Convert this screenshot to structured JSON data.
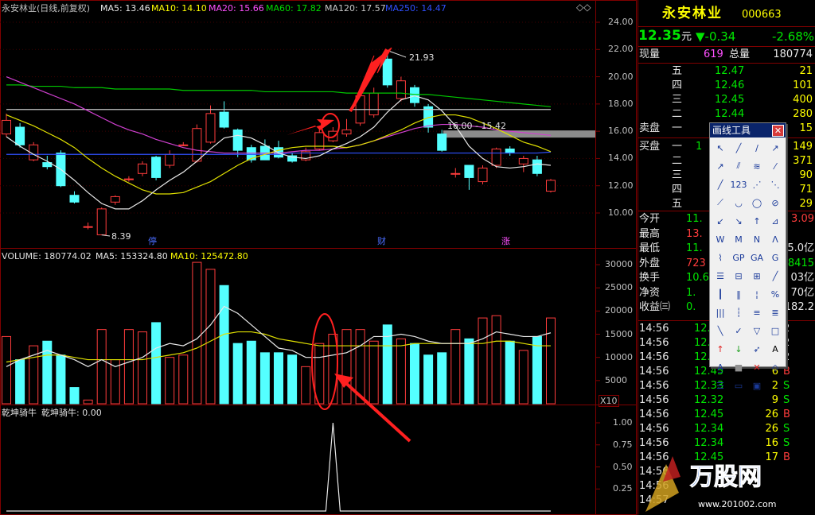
{
  "chart_header": {
    "title": "永安林业(日线,前复权)",
    "ma5": "MA5: 13.46",
    "ma10": "MA10: 14.10",
    "ma20": "MA20: 15.66",
    "ma60": "MA60: 17.82",
    "ma120": "MA120: 17.57",
    "ma250": "MA250: 14.47"
  },
  "price_axis": [
    "24.00",
    "22.00",
    "20.00",
    "18.00",
    "16.00",
    "14.00",
    "12.00",
    "10.00"
  ],
  "annotations": {
    "high": "21.93",
    "low": "8.39",
    "range": "16.00 - 15.42",
    "markers": [
      "停",
      "财",
      "涨"
    ]
  },
  "volume_header": {
    "label": "VOLUME: 180774.02",
    "ma5": "MA5: 153324.80",
    "ma10": "MA10: 125472.80"
  },
  "volume_axis": [
    "30000",
    "25000",
    "20000",
    "15000",
    "10000",
    "5000"
  ],
  "volume_unit": "X10",
  "indicator_header": {
    "name": "乾坤骑牛",
    "value": "乾坤骑牛: 0.00"
  },
  "indicator_axis": [
    "1.00",
    "0.75",
    "0.50",
    "0.25"
  ],
  "chart_data": {
    "type": "candlestick",
    "candles": [
      {
        "o": 15.8,
        "c": 16.8,
        "h": 17.3,
        "l": 15.6
      },
      {
        "o": 16.3,
        "c": 15.0,
        "h": 16.6,
        "l": 14.8
      },
      {
        "o": 13.9,
        "c": 15.0,
        "h": 15.2,
        "l": 13.8
      },
      {
        "o": 13.7,
        "c": 13.4,
        "h": 14.2,
        "l": 13.2
      },
      {
        "o": 14.4,
        "c": 12.0,
        "h": 14.6,
        "l": 11.9
      },
      {
        "o": 11.3,
        "c": 10.8,
        "h": 11.6,
        "l": 10.7
      },
      {
        "o": 9.0,
        "c": 9.0,
        "h": 9.3,
        "l": 8.8
      },
      {
        "o": 8.4,
        "c": 10.3,
        "h": 10.4,
        "l": 8.39
      },
      {
        "o": 10.8,
        "c": 11.2,
        "h": 11.3,
        "l": 10.6
      },
      {
        "o": 12.5,
        "c": 12.5,
        "h": 12.7,
        "l": 12.3
      },
      {
        "o": 12.9,
        "c": 13.6,
        "h": 13.8,
        "l": 12.7
      },
      {
        "o": 14.1,
        "c": 12.6,
        "h": 14.2,
        "l": 12.4
      },
      {
        "o": 13.5,
        "c": 14.3,
        "h": 14.6,
        "l": 13.3
      },
      {
        "o": 15.0,
        "c": 15.0,
        "h": 15.2,
        "l": 14.9
      },
      {
        "o": 13.8,
        "c": 16.2,
        "h": 16.5,
        "l": 13.7
      },
      {
        "o": 15.2,
        "c": 17.3,
        "h": 17.9,
        "l": 15.1
      },
      {
        "o": 17.4,
        "c": 16.3,
        "h": 18.2,
        "l": 16.2
      },
      {
        "o": 16.1,
        "c": 14.6,
        "h": 16.2,
        "l": 14.1
      },
      {
        "o": 14.8,
        "c": 13.9,
        "h": 15.0,
        "l": 13.7
      },
      {
        "o": 14.9,
        "c": 13.9,
        "h": 15.4,
        "l": 13.9
      },
      {
        "o": 14.8,
        "c": 14.1,
        "h": 15.3,
        "l": 14.0
      },
      {
        "o": 14.2,
        "c": 13.8,
        "h": 14.4,
        "l": 13.7
      },
      {
        "o": 13.9,
        "c": 14.5,
        "h": 14.8,
        "l": 13.8
      },
      {
        "o": 14.7,
        "c": 15.9,
        "h": 16.2,
        "l": 14.6
      },
      {
        "o": 15.3,
        "c": 16.0,
        "h": 16.3,
        "l": 15.2
      },
      {
        "o": 15.8,
        "c": 16.1,
        "h": 16.9,
        "l": 15.6
      },
      {
        "o": 16.6,
        "c": 18.6,
        "h": 18.8,
        "l": 16.4
      },
      {
        "o": 17.2,
        "c": 18.8,
        "h": 19.2,
        "l": 17.0
      },
      {
        "o": 21.3,
        "c": 19.4,
        "h": 21.93,
        "l": 19.2
      },
      {
        "o": 18.4,
        "c": 19.7,
        "h": 20.0,
        "l": 18.2
      },
      {
        "o": 19.2,
        "c": 18.1,
        "h": 19.4,
        "l": 17.8
      },
      {
        "o": 17.8,
        "c": 16.3,
        "h": 18.0,
        "l": 15.9
      },
      {
        "o": 15.8,
        "c": 14.6,
        "h": 16.1,
        "l": 14.5
      },
      {
        "o": 12.9,
        "c": 12.9,
        "h": 13.3,
        "l": 12.6
      },
      {
        "o": 13.5,
        "c": 12.6,
        "h": 13.5,
        "l": 11.7
      },
      {
        "o": 12.3,
        "c": 13.3,
        "h": 13.5,
        "l": 12.1
      },
      {
        "o": 13.5,
        "c": 14.7,
        "h": 14.8,
        "l": 13.3
      },
      {
        "o": 14.7,
        "c": 14.4,
        "h": 14.9,
        "l": 14.2
      },
      {
        "o": 13.6,
        "c": 14.0,
        "h": 14.2,
        "l": 13.0
      },
      {
        "o": 13.9,
        "c": 12.9,
        "h": 14.2,
        "l": 12.7
      },
      {
        "o": 11.6,
        "c": 12.4,
        "h": 12.5,
        "l": 11.5
      }
    ],
    "volume": [
      14500,
      9500,
      12500,
      13500,
      10500,
      3500,
      800,
      16000,
      9500,
      16000,
      15500,
      17500,
      10000,
      10500,
      30500,
      29000,
      25500,
      13000,
      13500,
      11000,
      11000,
      10500,
      8000,
      13000,
      15000,
      16000,
      16000,
      13500,
      17000,
      14000,
      13000,
      10500,
      11000,
      16000,
      14000,
      18500,
      19000,
      13500,
      11500,
      14500,
      18500
    ],
    "ma5_price": [
      15.6,
      14.9,
      14.3,
      13.8,
      13.2,
      12.4,
      11.5,
      10.7,
      10.3,
      10.3,
      10.9,
      11.7,
      12.4,
      13.0,
      13.8,
      14.7,
      15.5,
      15.7,
      15.5,
      15.0,
      14.4,
      14.1,
      14.0,
      14.2,
      14.7,
      15.1,
      15.6,
      16.3,
      17.4,
      18.3,
      18.6,
      18.3,
      17.5,
      16.4,
      14.9,
      14.0,
      13.4,
      13.3,
      13.4,
      13.6,
      13.5
    ],
    "ma10_price": [
      17.2,
      16.8,
      16.4,
      15.9,
      15.4,
      14.8,
      14.0,
      13.3,
      12.7,
      12.2,
      11.7,
      11.4,
      11.4,
      11.5,
      11.9,
      12.3,
      12.9,
      13.5,
      14.0,
      14.3,
      14.6,
      14.8,
      14.9,
      14.9,
      14.9,
      14.8,
      15.0,
      15.3,
      15.7,
      16.1,
      16.6,
      17.0,
      17.2,
      17.2,
      17.0,
      16.6,
      16.2,
      15.7,
      15.2,
      14.9,
      14.5
    ],
    "ma20_price": [
      20.0,
      19.6,
      19.2,
      18.8,
      18.4,
      18.0,
      17.5,
      17.0,
      16.5,
      16.1,
      15.8,
      15.4,
      15.1,
      14.8,
      14.6,
      14.5,
      14.4,
      14.4,
      14.4,
      14.4,
      14.4,
      14.5,
      14.6,
      14.6,
      14.7,
      14.8,
      15.0,
      15.3,
      15.6,
      15.9,
      16.2,
      16.4,
      16.5,
      16.5,
      16.4,
      16.3,
      16.1,
      16.0,
      15.9,
      15.8,
      15.7
    ],
    "ma60_price": [
      19.4,
      19.4,
      19.3,
      19.3,
      19.3,
      19.2,
      19.2,
      19.2,
      19.1,
      19.1,
      19.1,
      19.1,
      19.1,
      19.0,
      19.0,
      19.0,
      19.0,
      19.0,
      19.0,
      18.9,
      18.9,
      18.9,
      18.9,
      18.9,
      18.9,
      18.8,
      18.8,
      18.8,
      18.8,
      18.8,
      18.7,
      18.7,
      18.6,
      18.5,
      18.4,
      18.3,
      18.2,
      18.1,
      18.0,
      17.9,
      17.8
    ],
    "ma120_price": [
      17.6,
      17.6,
      17.6,
      17.6,
      17.6,
      17.6,
      17.6,
      17.6,
      17.6,
      17.6,
      17.6,
      17.6,
      17.6,
      17.6,
      17.6,
      17.6,
      17.6,
      17.6,
      17.6,
      17.6,
      17.6,
      17.6,
      17.6,
      17.6,
      17.6,
      17.6,
      17.6,
      17.6,
      17.6,
      17.6,
      17.6,
      17.6,
      17.6,
      17.6,
      17.6,
      17.6,
      17.6,
      17.6,
      17.6,
      17.6,
      17.6
    ],
    "ma250_price": [
      14.3,
      14.3,
      14.3,
      14.3,
      14.3,
      14.3,
      14.3,
      14.3,
      14.3,
      14.3,
      14.3,
      14.3,
      14.3,
      14.3,
      14.3,
      14.3,
      14.3,
      14.3,
      14.3,
      14.3,
      14.3,
      14.4,
      14.4,
      14.4,
      14.4,
      14.4,
      14.4,
      14.4,
      14.4,
      14.4,
      14.4,
      14.4,
      14.4,
      14.4,
      14.4,
      14.4,
      14.4,
      14.4,
      14.4,
      14.4,
      14.47
    ],
    "vol_ma5": [
      8000,
      9500,
      10500,
      11500,
      10500,
      9500,
      8000,
      9500,
      8000,
      9000,
      10000,
      12000,
      13000,
      12500,
      14000,
      17000,
      21000,
      19500,
      17000,
      14500,
      12000,
      11500,
      10000,
      10000,
      10500,
      11000,
      12500,
      14500,
      14500,
      15000,
      14500,
      13500,
      13000,
      13000,
      13000,
      14000,
      15500,
      15000,
      14500,
      14500,
      15300
    ],
    "vol_ma10": [
      9000,
      9500,
      10000,
      10500,
      10500,
      10000,
      9500,
      9500,
      9500,
      9500,
      9500,
      10000,
      10500,
      11000,
      12000,
      13500,
      15000,
      15500,
      15500,
      15000,
      14000,
      13500,
      13000,
      12500,
      12500,
      12500,
      12500,
      12500,
      12500,
      12500,
      13000,
      13000,
      13000,
      13000,
      13000,
      13000,
      13500,
      13500,
      13000,
      12500,
      12500
    ],
    "indicator": [
      0,
      0,
      0,
      0,
      0,
      0,
      0,
      0,
      0,
      0,
      0,
      0,
      0,
      0,
      0,
      0,
      0,
      0,
      0,
      0,
      0,
      0,
      0,
      0,
      0,
      0,
      0,
      0,
      0,
      0,
      1,
      0,
      0,
      0,
      0,
      0,
      0,
      0,
      0,
      0,
      0
    ],
    "indicator_spike_index": 24,
    "ylim": [
      8.39,
      24.0
    ],
    "vol_ylim": [
      0,
      31000
    ],
    "ind_ylim": [
      0,
      1.1
    ]
  },
  "stock": {
    "name": "永安林业",
    "code": "000663",
    "price": "12.35",
    "unit": "元",
    "change": "▼-0.34",
    "pct": "-2.68%"
  },
  "quote": {
    "vol_label": "现量",
    "vol_value": "619",
    "total_label": "总量",
    "total_value": "180774",
    "sell_label": "卖盘",
    "buy_label": "买盘",
    "sell_levels": [
      {
        "name": "五",
        "price": "12.47",
        "qty": "21"
      },
      {
        "name": "四",
        "price": "12.46",
        "qty": "101"
      },
      {
        "name": "三",
        "price": "12.45",
        "qty": "400"
      },
      {
        "name": "二",
        "price": "12.44",
        "qty": "280"
      },
      {
        "name": "一",
        "price": "1",
        "qty": "15"
      }
    ],
    "buy_levels": [
      {
        "name": "一",
        "price": "1",
        "qty": "149"
      },
      {
        "name": "二",
        "price": "",
        "qty": "371"
      },
      {
        "name": "三",
        "price": "",
        "qty": "90"
      },
      {
        "name": "四",
        "price": "",
        "qty": "71"
      },
      {
        "name": "五",
        "price": "",
        "qty": "29"
      }
    ]
  },
  "stats": [
    {
      "label": "今开",
      "value": "11.",
      "tail": "3.09"
    },
    {
      "label": "最高",
      "value": "13.",
      "tail": ""
    },
    {
      "label": "最低",
      "value": "11.",
      "tail": "5.0亿"
    },
    {
      "label": "外盘",
      "value": "723",
      "tail": "8415"
    },
    {
      "label": "换手",
      "value": "10.6",
      "tail": "03亿"
    },
    {
      "label": "净资",
      "value": "1.",
      "tail": "70亿"
    },
    {
      "label": "收益㈢",
      "value": "0.",
      "tail": "182.2"
    }
  ],
  "ticks": [
    {
      "time": "14:56",
      "price": "12.",
      "vol": "",
      "side": "2"
    },
    {
      "time": "14:56",
      "price": "12.",
      "vol": "",
      "side": "2"
    },
    {
      "time": "14:56",
      "price": "12.",
      "vol": "",
      "side": "2"
    },
    {
      "time": "14:56",
      "price": "12.45",
      "vol": "6",
      "side": "B"
    },
    {
      "time": "14:56",
      "price": "12.33",
      "vol": "2",
      "side": "S"
    },
    {
      "time": "14:56",
      "price": "12.32",
      "vol": "9",
      "side": "S"
    },
    {
      "time": "14:56",
      "price": "12.45",
      "vol": "26",
      "side": "B"
    },
    {
      "time": "14:56",
      "price": "12.34",
      "vol": "26",
      "side": "S"
    },
    {
      "time": "14:56",
      "price": "12.34",
      "vol": "16",
      "side": "S"
    },
    {
      "time": "14:56",
      "price": "12.45",
      "vol": "17",
      "side": "B"
    },
    {
      "time": "14:56",
      "price": "",
      "vol": "",
      "side": ""
    },
    {
      "time": "14:56",
      "price": "",
      "vol": "",
      "side": ""
    },
    {
      "time": "14:57",
      "price": "",
      "vol": "",
      "side": ""
    }
  ],
  "draw_tools": {
    "title": "画线工具",
    "close": "✕",
    "tools": [
      "arrow-cursor",
      "line-segment",
      "straight-line",
      "ray",
      "arrow-line",
      "parallel-line",
      "price-channel",
      "vertical-line",
      "horizontal-line",
      "fib-lines",
      "gann-lines",
      "speed-lines",
      "bisect",
      "arc",
      "circle",
      "clear-circle",
      "period-lines",
      "fib-ray",
      "price-marker",
      "angle-line",
      "wave-w",
      "wave-m",
      "wave-n",
      "wave-a",
      "gann-fan",
      "gp-tool",
      "ga-tool",
      "g-tool",
      "trend-fan",
      "rect-line",
      "fib-fan",
      "regression",
      "vert-bars",
      "bar-grid",
      "golden-ratio",
      "percentage",
      "line-bars",
      "bar-set",
      "fib-period",
      "speed-fan",
      "zigzag",
      "checkmark",
      "down-tri",
      "rectangle",
      "up-arrow",
      "down-arrow",
      "arrow-cross",
      "text-a",
      "text-tool",
      "gray-box",
      "delete-x",
      "eraser",
      "note-list",
      "ruler",
      "chart-pic",
      ""
    ]
  },
  "watermark": {
    "brand": "万股网",
    "url": "www.201002.com"
  }
}
